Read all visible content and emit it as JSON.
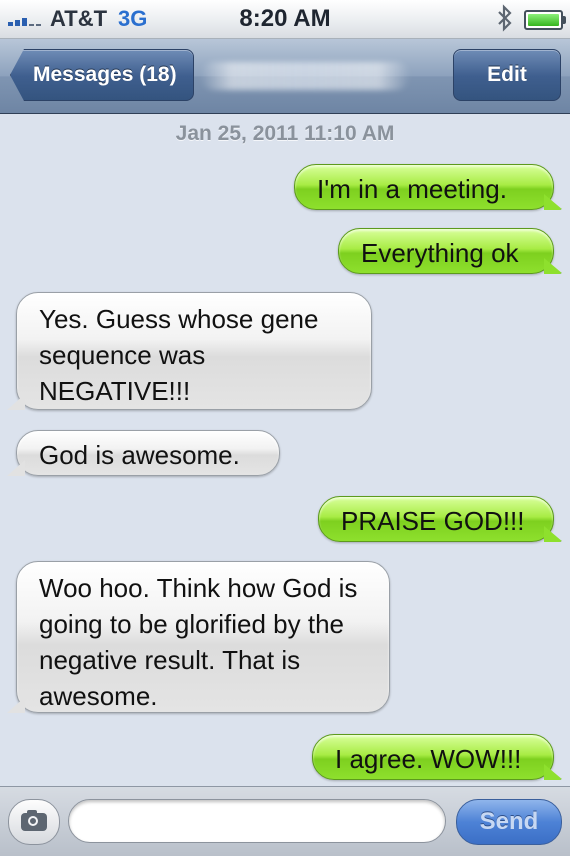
{
  "status_bar": {
    "carrier": "AT&T",
    "network": "3G",
    "time": "8:20 AM",
    "icons": [
      "signal-bars-icon",
      "bluetooth-icon",
      "battery-icon"
    ],
    "battery_level_percent": 100
  },
  "nav": {
    "back_label": "Messages (18)",
    "edit_label": "Edit",
    "contact_name_blurred": true
  },
  "conversation": {
    "timestamp": "Jan 25, 2011 11:10 AM",
    "messages": [
      {
        "from": "me",
        "text": "I'm in a meeting."
      },
      {
        "from": "me",
        "text": "Everything ok"
      },
      {
        "from": "them",
        "text": "Yes. Guess whose gene sequence was NEGATIVE!!!"
      },
      {
        "from": "them",
        "text": "God is awesome."
      },
      {
        "from": "me",
        "text": "PRAISE GOD!!!"
      },
      {
        "from": "them",
        "text": "Woo hoo. Think how God is going to be glorified by the negative result. That is awesome."
      },
      {
        "from": "me",
        "text": "I agree. WOW!!!"
      }
    ]
  },
  "input_bar": {
    "message_value": "",
    "send_label": "Send",
    "camera_icon": "camera-icon"
  },
  "colors": {
    "sent_bubble": "#8ee02d",
    "received_bubble": "#e4e4e4",
    "navbar": "#7f95b2",
    "send_button": "#4d82d6",
    "background": "#dbe2ed"
  }
}
